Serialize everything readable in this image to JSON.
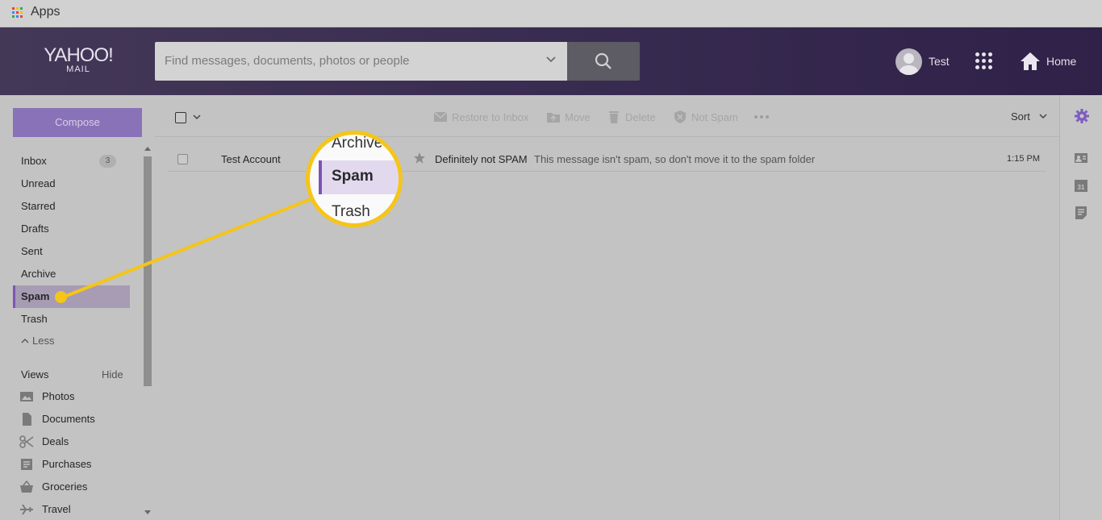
{
  "appsbar": {
    "label": "Apps",
    "grid_colors": [
      "#e94235",
      "#fbbc04",
      "#34a853",
      "#4285f4",
      "#e94235",
      "#fbbc04",
      "#34a853",
      "#4285f4",
      "#e94235"
    ]
  },
  "header": {
    "logo_main": "YAHOO!",
    "logo_sub": "MAIL",
    "search_placeholder": "Find messages, documents, photos or people",
    "user_name": "Test",
    "home_label": "Home"
  },
  "sidebar": {
    "compose_label": "Compose",
    "folders": [
      {
        "label": "Inbox",
        "count": "3"
      },
      {
        "label": "Unread"
      },
      {
        "label": "Starred"
      },
      {
        "label": "Drafts"
      },
      {
        "label": "Sent"
      },
      {
        "label": "Archive"
      },
      {
        "label": "Spam"
      },
      {
        "label": "Trash"
      }
    ],
    "less_label": "Less",
    "views_label": "Views",
    "hide_label": "Hide",
    "views": [
      {
        "label": "Photos",
        "icon": "photo-icon"
      },
      {
        "label": "Documents",
        "icon": "document-icon"
      },
      {
        "label": "Deals",
        "icon": "scissors-icon"
      },
      {
        "label": "Purchases",
        "icon": "receipt-icon"
      },
      {
        "label": "Groceries",
        "icon": "basket-icon"
      },
      {
        "label": "Travel",
        "icon": "plane-icon"
      }
    ]
  },
  "toolbar": {
    "restore_label": "Restore to Inbox",
    "move_label": "Move",
    "delete_label": "Delete",
    "not_spam_label": "Not Spam",
    "sort_label": "Sort"
  },
  "messages": [
    {
      "from": "Test Account",
      "subject": "Definitely not SPAM",
      "snippet": "This message isn't spam, so don't move it to the spam folder",
      "time": "1:15 PM"
    }
  ],
  "callout": {
    "archive": "Archive",
    "spam": "Spam",
    "trash": "Trash",
    "accent_color": "#f5c518"
  },
  "colors": {
    "header_purple": "#3a2d52",
    "compose_purple": "#8a72b8",
    "active_accent": "#7d55b5"
  }
}
